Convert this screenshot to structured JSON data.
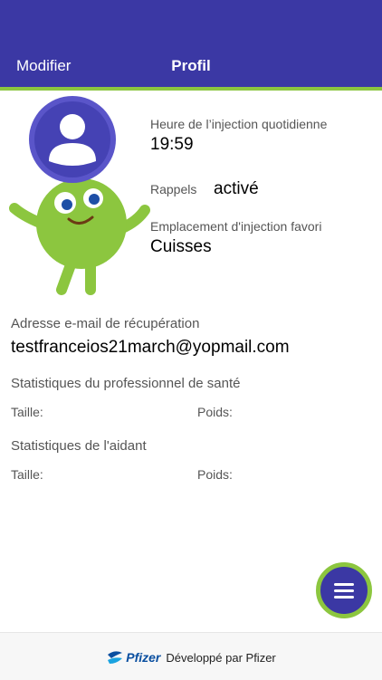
{
  "header": {
    "edit_label": "Modifier",
    "title": "Profil"
  },
  "injection": {
    "time_label": "Heure de l’injection quotidienne",
    "time_value": "19:59"
  },
  "reminders": {
    "label": "Rappels",
    "value": "activé"
  },
  "site": {
    "label": "Emplacement d'injection favori",
    "value": "Cuisses"
  },
  "recovery": {
    "label": "Adresse e-mail de récupération",
    "value": "testfranceios21march@yopmail.com"
  },
  "health_stats": {
    "title": "Statistiques du professionnel de santé",
    "height_label": "Taille:",
    "weight_label": "Poids:"
  },
  "caregiver_stats": {
    "title": "Statistiques de l'aidant",
    "height_label": "Taille:",
    "weight_label": "Poids:"
  },
  "footer": {
    "brand": "Pfizer",
    "text": "Développé par Pfizer"
  },
  "colors": {
    "primary": "#3b38a4",
    "accent": "#8cc63f"
  }
}
